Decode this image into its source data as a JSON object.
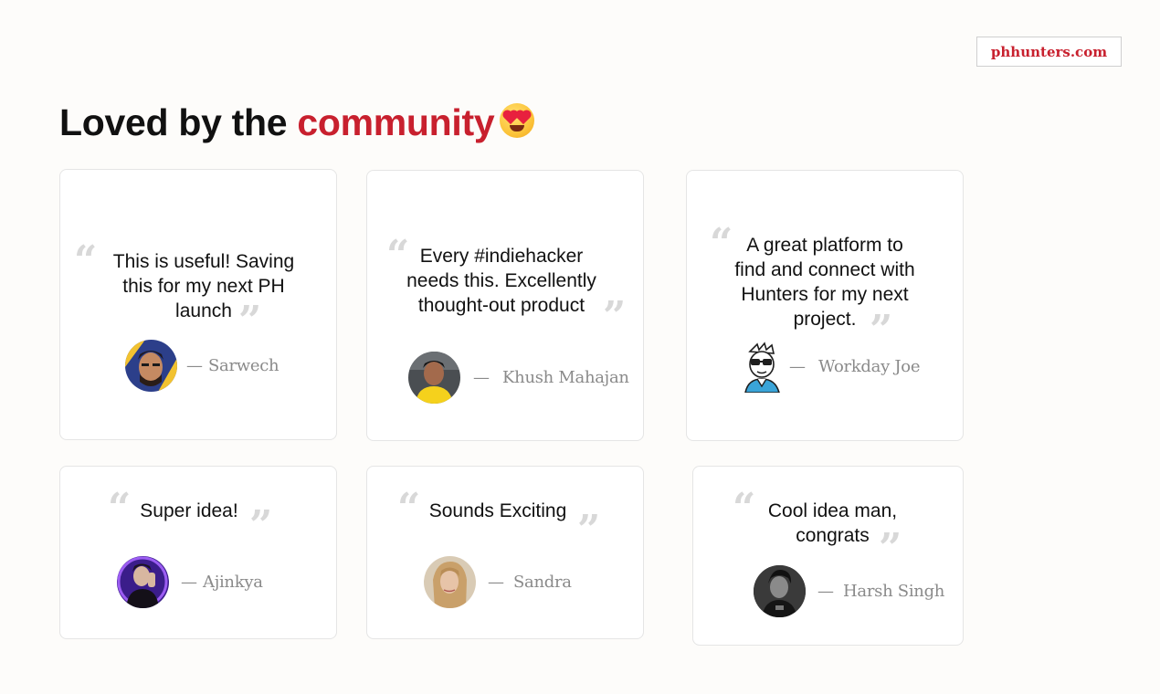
{
  "site_badge": "phhunters.com",
  "heading": {
    "prefix": "Loved by the ",
    "accent": "community",
    "emoji_icon": "heart-eyes-emoji-icon"
  },
  "colors": {
    "accent": "#c8202e",
    "quote_mark": "#d8d8d8",
    "author": "#8a8a8a"
  },
  "testimonials": [
    {
      "quote_lines": [
        "This is useful! Saving",
        "this for my next PH",
        "launch"
      ],
      "dash": "—",
      "author": "Sarwech"
    },
    {
      "quote_lines": [
        "Every #indiehacker",
        "needs this. Excellently",
        "thought-out product"
      ],
      "dash": "—",
      "author": "Khush Mahajan"
    },
    {
      "quote_lines": [
        "A great platform to",
        "find and connect with",
        "Hunters for my next",
        "project."
      ],
      "dash": "—",
      "author": "Workday Joe"
    },
    {
      "quote_lines": [
        "Super idea!"
      ],
      "dash": "—",
      "author": "Ajinkya"
    },
    {
      "quote_lines": [
        "Sounds Exciting"
      ],
      "dash": "—",
      "author": "Sandra"
    },
    {
      "quote_lines": [
        "Cool idea man,",
        "congrats"
      ],
      "dash": "—",
      "author": "Harsh Singh"
    }
  ],
  "quote_open": "“",
  "quote_close": "”"
}
